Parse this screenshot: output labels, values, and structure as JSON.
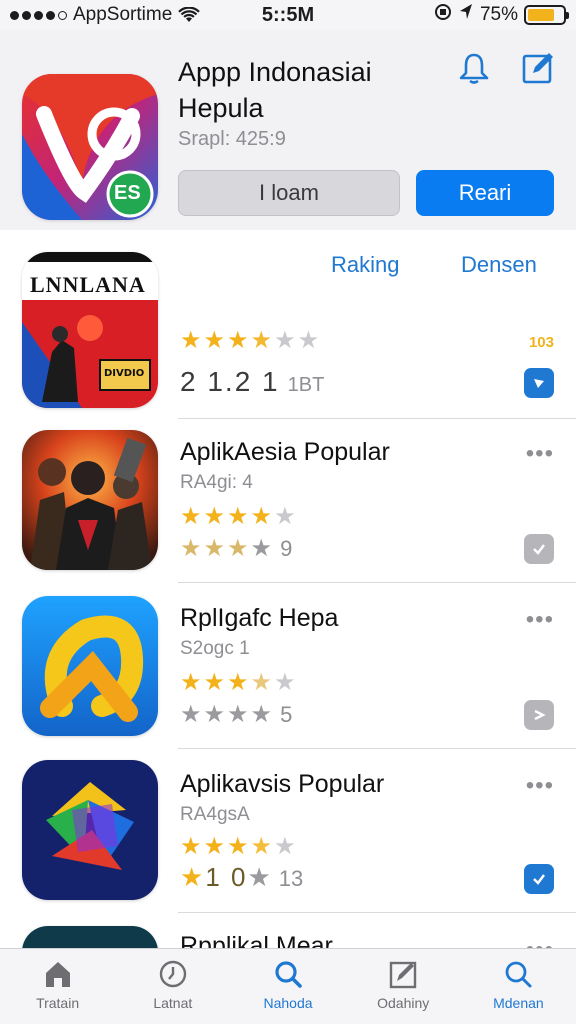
{
  "status_bar": {
    "carrier": "AppSortime",
    "time": "5::5M",
    "battery": "75%",
    "battery_level": 0.75
  },
  "header": {
    "title": "Appp Indonasiai Hepula",
    "subtitle": "Srapl: 425:9",
    "badge_text": "ES",
    "secondary_button": "I loam",
    "primary_button": "Reari",
    "icons": [
      "bell-icon",
      "edit-icon"
    ]
  },
  "filters": {
    "left": "Raking",
    "right": "Densen"
  },
  "apps": [
    {
      "icon_text_top": "LNNLANA",
      "icon_text_badge": "DIVDIO",
      "stars_filled": 3.5,
      "side_number": "103",
      "rating_main": "2 1.2 1",
      "rating_count": "1BT",
      "badge": "blue"
    },
    {
      "name": "AplikAesia Popular",
      "sub": "RA4gi: 4",
      "stars_filled": 3.5,
      "second_row_count": "9",
      "badge": "gray"
    },
    {
      "name": "RplIgafc Hepa",
      "sub": "S2ogc 1",
      "stars_filled": 3,
      "second_row_count": "5",
      "badge": "gray"
    },
    {
      "name": "Aplikavsis Popular",
      "sub": "RA4gsA",
      "stars_filled": 3.5,
      "second_row_prefix": "1 0",
      "second_row_count": "13",
      "badge": "blue"
    },
    {
      "name": "Rpplikal Mear"
    }
  ],
  "tabbar": {
    "items": [
      {
        "label": "Tratain",
        "icon": "home-icon"
      },
      {
        "label": "Latnat",
        "icon": "clock-icon"
      },
      {
        "label": "Nahoda",
        "icon": "search-icon",
        "active": true
      },
      {
        "label": "Odahiny",
        "icon": "edit-square-icon"
      },
      {
        "label": "Mdenan",
        "icon": "search-icon-2",
        "active": true
      }
    ]
  },
  "colors": {
    "accent": "#0a7cf2",
    "star": "#f3b21b",
    "header_bg": "#f2f2f5"
  }
}
